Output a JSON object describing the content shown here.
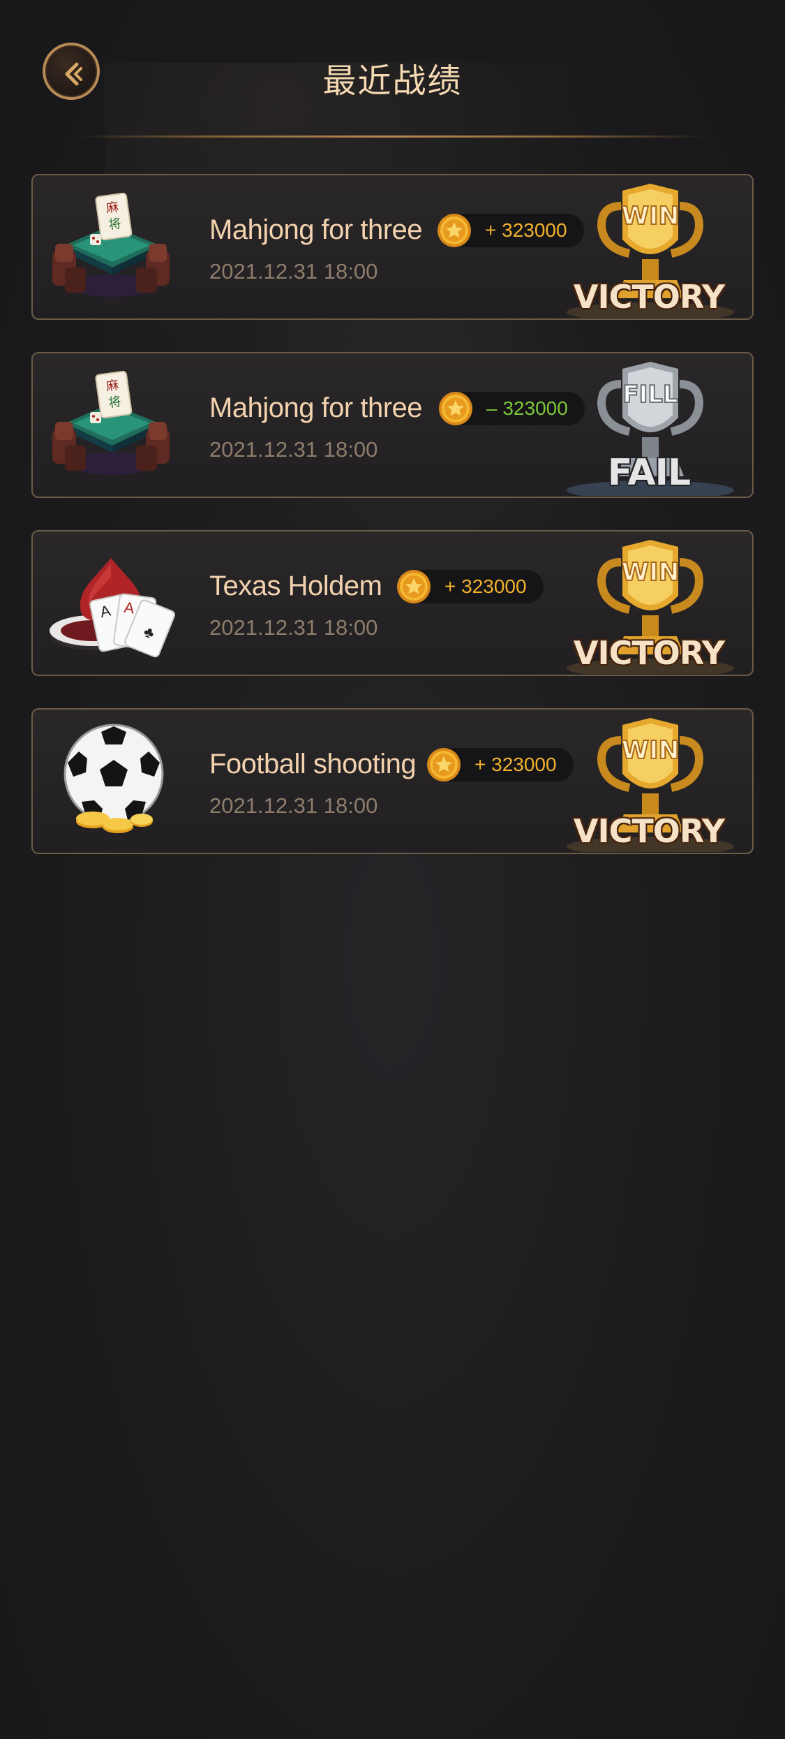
{
  "header": {
    "title": "最近战绩",
    "back_icon": "chevron-left-icon"
  },
  "colors": {
    "title": "#f5d9b2",
    "gold_accent": "#b88a56",
    "win_score": "#f2b22c",
    "lose_score": "#7ec83a"
  },
  "records": [
    {
      "game": "Mahjong for three",
      "icon": "mahjong-table-icon",
      "score": "+ 323000",
      "time": "2021.12.31 18:00",
      "result": "VICTORY",
      "trophy_text": "WIN",
      "outcome": "win"
    },
    {
      "game": "Mahjong for three",
      "icon": "mahjong-table-icon",
      "score": "– 323000",
      "time": "2021.12.31 18:00",
      "result": "FAIL",
      "trophy_text": "FILL",
      "outcome": "lose"
    },
    {
      "game": "Texas Holdem",
      "icon": "poker-cards-icon",
      "score": "+ 323000",
      "time": "2021.12.31 18:00",
      "result": "VICTORY",
      "trophy_text": "WIN",
      "outcome": "win"
    },
    {
      "game": "Football shooting",
      "icon": "soccer-ball-icon",
      "score": "+ 323000",
      "time": "2021.12.31 18:00",
      "result": "VICTORY",
      "trophy_text": "WIN",
      "outcome": "win"
    }
  ]
}
